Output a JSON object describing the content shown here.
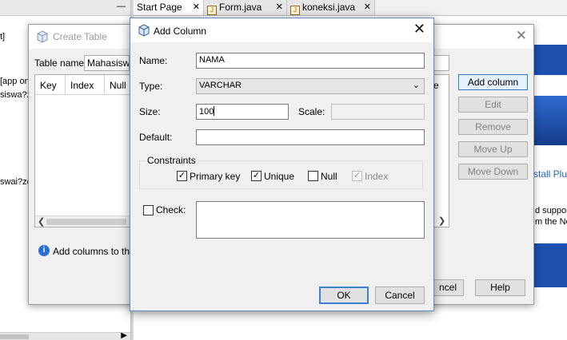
{
  "ide": {
    "left_panel_lines": [
      "[app on",
      "siswa?z",
      "swai?zero"
    ],
    "left_panel_top_fragment": "t]",
    "minimize_glyph": "—",
    "editor_tabs": [
      {
        "label": "Start Page",
        "icon": "none",
        "active": true
      },
      {
        "label": "Form.java",
        "icon": "java-form-icon",
        "active": false
      },
      {
        "label": "koneksi.java",
        "icon": "java-file-icon",
        "active": false
      }
    ],
    "tab_close_glyph": "✕",
    "right_panel": {
      "link_text": "stall Plu",
      "text_lines": [
        "d suppor",
        "m the Ne"
      ]
    }
  },
  "create_table": {
    "title": "Create Table",
    "table_name_label": "Table name:",
    "table_name_value": "Mahasiswa",
    "columns": [
      "Key",
      "Index",
      "Null"
    ],
    "right_fragment": "e",
    "side_buttons": [
      {
        "label": "Add column",
        "enabled": true
      },
      {
        "label": "Edit",
        "enabled": false
      },
      {
        "label": "Remove",
        "enabled": false
      },
      {
        "label": "Move Up",
        "enabled": false
      },
      {
        "label": "Move Down",
        "enabled": false
      }
    ],
    "info_text": "Add columns to the",
    "cancel_label": "Cancel",
    "cancel_visible": "ncel",
    "help_label": "Help"
  },
  "add_column": {
    "title": "Add Column",
    "name_label": "Name:",
    "name_value": "NAMA",
    "type_label": "Type:",
    "type_value": "VARCHAR",
    "size_label": "Size:",
    "size_value": "100",
    "scale_label": "Scale:",
    "scale_value": "",
    "default_label": "Default:",
    "default_value": "",
    "constraints_label": "Constraints",
    "constraints": {
      "primary_key": {
        "label": "Primary key",
        "checked": true,
        "enabled": true
      },
      "unique": {
        "label": "Unique",
        "checked": true,
        "enabled": true
      },
      "null": {
        "label": "Null",
        "checked": false,
        "enabled": true
      },
      "index": {
        "label": "Index",
        "checked": true,
        "enabled": false
      }
    },
    "check_label": "Check:",
    "check_checked": false,
    "check_value": "",
    "ok_label": "OK",
    "cancel_label": "Cancel"
  },
  "colors": {
    "accent_blue": "#3c7fd4",
    "brand_blue": "#1c4fae",
    "link_blue": "#1f63c6"
  }
}
